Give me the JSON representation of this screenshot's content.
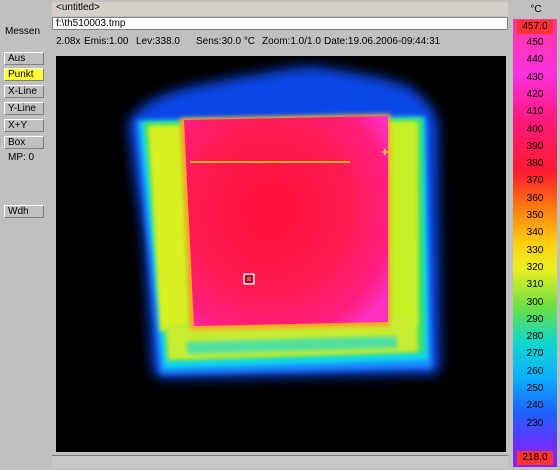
{
  "window": {
    "title": "<untitled>",
    "file_path": "f:\\th510003.tmp"
  },
  "left_panel": {
    "title": "Messen",
    "buttons": [
      {
        "label": "Aus",
        "active": false
      },
      {
        "label": "Punkt",
        "active": true
      },
      {
        "label": "X-Line",
        "active": false
      },
      {
        "label": "Y-Line",
        "active": false
      },
      {
        "label": "X+Y",
        "active": false
      },
      {
        "label": "Box",
        "active": false
      }
    ],
    "mp_text": "MP: 0",
    "wdh_label": "Wdh"
  },
  "infobar": {
    "zoom_factor": "2.08x",
    "emis": "Emis:1.00",
    "lev": "Lev:338.0",
    "sens": "Sens:30.0 °C",
    "zoom": "Zoom:1.0/1.0",
    "date": "Date:19.06.2006-09:44:31"
  },
  "scale": {
    "unit": "°C",
    "max_label": "457.0",
    "min_label": "218.0",
    "labels": [
      "450",
      "440",
      "430",
      "420",
      "410",
      "400",
      "390",
      "380",
      "370",
      "360",
      "350",
      "340",
      "330",
      "320",
      "310",
      "300",
      "290",
      "280",
      "270",
      "260",
      "250",
      "240",
      "230"
    ]
  },
  "colors": {
    "max_marker": "#ff3333",
    "min_marker": "#ff3333",
    "active_button": "#ffff33"
  }
}
